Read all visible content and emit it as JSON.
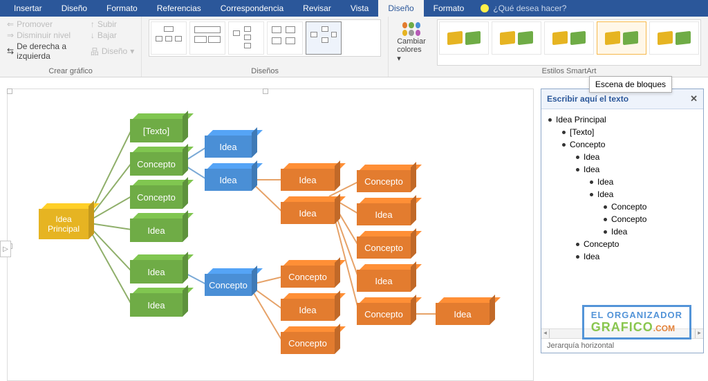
{
  "tabs": [
    "Insertar",
    "Diseño",
    "Formato",
    "Referencias",
    "Correspondencia",
    "Revisar",
    "Vista",
    "Diseño",
    "Formato"
  ],
  "active_tab_index": 7,
  "tell_me": "¿Qué desea hacer?",
  "group1": {
    "promote": "Promover",
    "demote": "Disminuir nivel",
    "rtl": "De derecha a izquierda",
    "up": "Subir",
    "down": "Bajar",
    "layout": "Diseño",
    "label": "Crear gráfico"
  },
  "group_layouts_label": "Diseños",
  "change_colors": {
    "line1": "Cambiar",
    "line2": "colores"
  },
  "group_styles_label": "Estilos SmartArt",
  "tooltip": "Escena de bloques",
  "text_pane": {
    "title": "Escribir aquí el texto",
    "footer": "Jerarquía horizontal",
    "items": [
      {
        "level": 1,
        "text": "Idea Principal"
      },
      {
        "level": 2,
        "text": "[Texto]"
      },
      {
        "level": 2,
        "text": "Concepto"
      },
      {
        "level": 3,
        "text": "Idea"
      },
      {
        "level": 3,
        "text": "Idea"
      },
      {
        "level": 4,
        "text": "Idea"
      },
      {
        "level": 4,
        "text": "Idea"
      },
      {
        "level": 5,
        "text": "Concepto"
      },
      {
        "level": 5,
        "text": "Concepto"
      },
      {
        "level": 5,
        "text": "Idea"
      },
      {
        "level": 3,
        "text": "Concepto"
      },
      {
        "level": 3,
        "text": "Idea"
      }
    ]
  },
  "diagram": {
    "root": "Idea Principal",
    "l2": [
      "[Texto]",
      "Concepto",
      "Concepto",
      "Idea",
      "Idea",
      "Idea"
    ],
    "l3a": [
      "Idea",
      "Idea"
    ],
    "l3b": [
      "Concepto"
    ],
    "l4a": [
      "Idea",
      "Idea"
    ],
    "l4b": [
      "Concepto",
      "Idea",
      "Concepto"
    ],
    "l5": [
      "Concepto",
      "Idea",
      "Concepto",
      "Idea",
      "Concepto"
    ],
    "l6": [
      "Idea"
    ]
  },
  "colors": {
    "brand": "#2b579a",
    "yellow": "#e6b422",
    "green": "#6fac46",
    "blue": "#4a8fd6",
    "orange": "#e37c2f"
  },
  "watermark": {
    "line1": "EL ORGANIZADOR",
    "line2": "GRAFICO",
    "tld": ".COM"
  }
}
